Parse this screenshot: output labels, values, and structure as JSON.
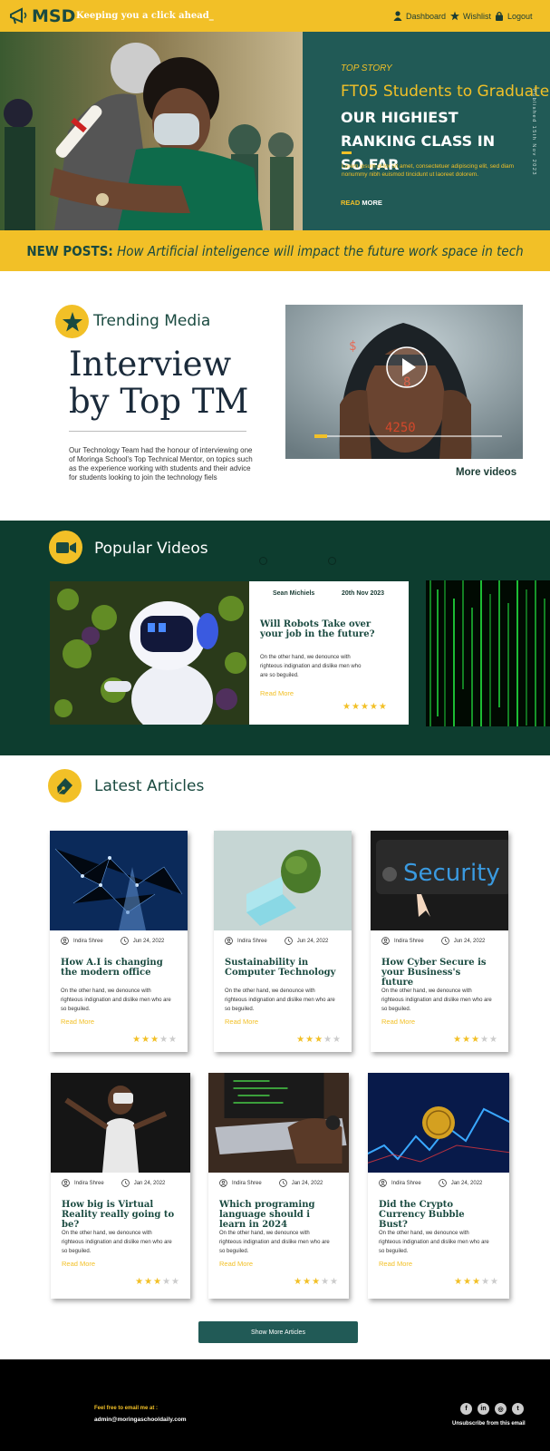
{
  "header": {
    "logo": "MSD",
    "tagline": "Keeping you a click ahead_",
    "nav": [
      {
        "label": "Dashboard",
        "icon": "user-icon"
      },
      {
        "label": "Wishlist",
        "icon": "star-icon"
      },
      {
        "label": "Logout",
        "icon": "lock-icon"
      }
    ]
  },
  "hero": {
    "kicker": "TOP STORY",
    "title_line1": "FT05 Students to Graduate",
    "title_line2": "OUR HIGHIEST RANKING CLASS IN SO FAR",
    "body": "Lorem ipsum dolor sit amet, consectetuer adipiscing elit, sed diam nonummy nibh euismod tincidunt ut laoreet dolorem.",
    "read": "READ",
    "more": "MORE",
    "published": "Published 15th Nov 2023"
  },
  "new_posts": {
    "label": "NEW POSTS:",
    "text": "How Artificial inteligence will impact the future work space in tech"
  },
  "trending": {
    "section_title": "Trending Media",
    "headline": "Interview by Top TM",
    "body": "Our Technology Team had the honour of interviewing one of Moringa School's Top Technical Mentor, on topics such as the experience working with students and their advice for students looking to join the technology fiels",
    "more_videos": "More videos",
    "video_progress": 0.07
  },
  "popular": {
    "section_title": "Popular Videos",
    "card": {
      "author": "Sean Michiels",
      "date": "20th Nov 2023",
      "title": "Will Robots Take over your job in the future?",
      "body": "On the other hand, we denounce with righteous indignation and dislike men who are so beguiled.",
      "read_more": "Read More",
      "rating": 5
    }
  },
  "articles": {
    "section_title": "Latest Articles",
    "items": [
      {
        "author": "Indira Shree",
        "date": "Jun 24, 2022",
        "title": "How A.I is changing the modern office",
        "body": "On the other hand, we denounce with righteous indignation and dislike men who are so beguiled.",
        "read_more": "Read More",
        "rating": 3
      },
      {
        "author": "Indira Shree",
        "date": "Jun 24, 2022",
        "title": "Sustainability in Computer Technology",
        "body": "On the other hand, we denounce with righteous indignation and dislike men who are so beguiled.",
        "read_more": "Read More",
        "rating": 3
      },
      {
        "author": "Indira Shree",
        "date": "Jun 24, 2022",
        "title": "How Cyber Secure is your Business's future",
        "body": "On the other hand, we denounce with righteous indignation and dislike men who are so beguiled.",
        "read_more": "Read More",
        "rating": 3
      },
      {
        "author": "Indira Shree",
        "date": "Jan 24, 2022",
        "title": "How big is Virtual Reality really going to be?",
        "body": "On the other hand, we denounce with righteous indignation and dislike men who are so beguiled.",
        "read_more": "Read More",
        "rating": 3
      },
      {
        "author": "Indira Shree",
        "date": "Jan 24, 2022",
        "title": "Which programing language should i learn in 2024",
        "body": "On the other hand, we denounce with righteous indignation and dislike men who are so beguiled.",
        "read_more": "Read More",
        "rating": 3
      },
      {
        "author": "Indira Shree",
        "date": "Jan 24, 2022",
        "title": "Did the Crypto Currency Bubble Bust?",
        "body": "On the other hand, we denounce with righteous indignation and dislike men who are so beguiled.",
        "read_more": "Read More",
        "rating": 3
      }
    ],
    "show_more": "Show More Articles"
  },
  "footer": {
    "email_label": "Feel free to email me at :",
    "email": "admin@moringaschooldaily.com",
    "unsubscribe": "Unsubscribe from this email",
    "socials": [
      "facebook-icon",
      "linkedin-icon",
      "instagram-icon",
      "twitter-icon"
    ]
  },
  "colors": {
    "accent": "#f2c027",
    "teal": "#215a56",
    "dark_green": "#0d3d2f"
  }
}
